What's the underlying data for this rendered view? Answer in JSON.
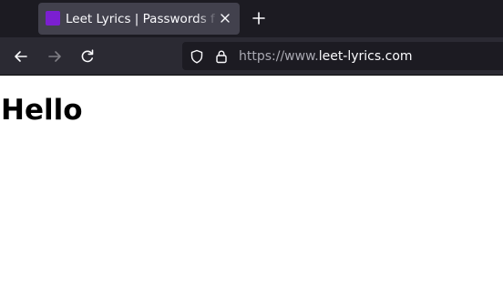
{
  "browser": {
    "tab": {
      "title": "Leet Lyrics | Passwords f",
      "favicon_color": "#7b1fd1"
    },
    "icons": {
      "tab_close": "close-icon",
      "new_tab": "plus-icon",
      "back": "arrow-left-icon",
      "forward": "arrow-right-icon",
      "reload": "reload-icon",
      "tracking_protection": "shield-icon",
      "secure": "lock-icon"
    },
    "url": {
      "prefix": "https://www.",
      "host": "leet-lyrics.com"
    }
  },
  "page": {
    "heading": "Hello"
  }
}
